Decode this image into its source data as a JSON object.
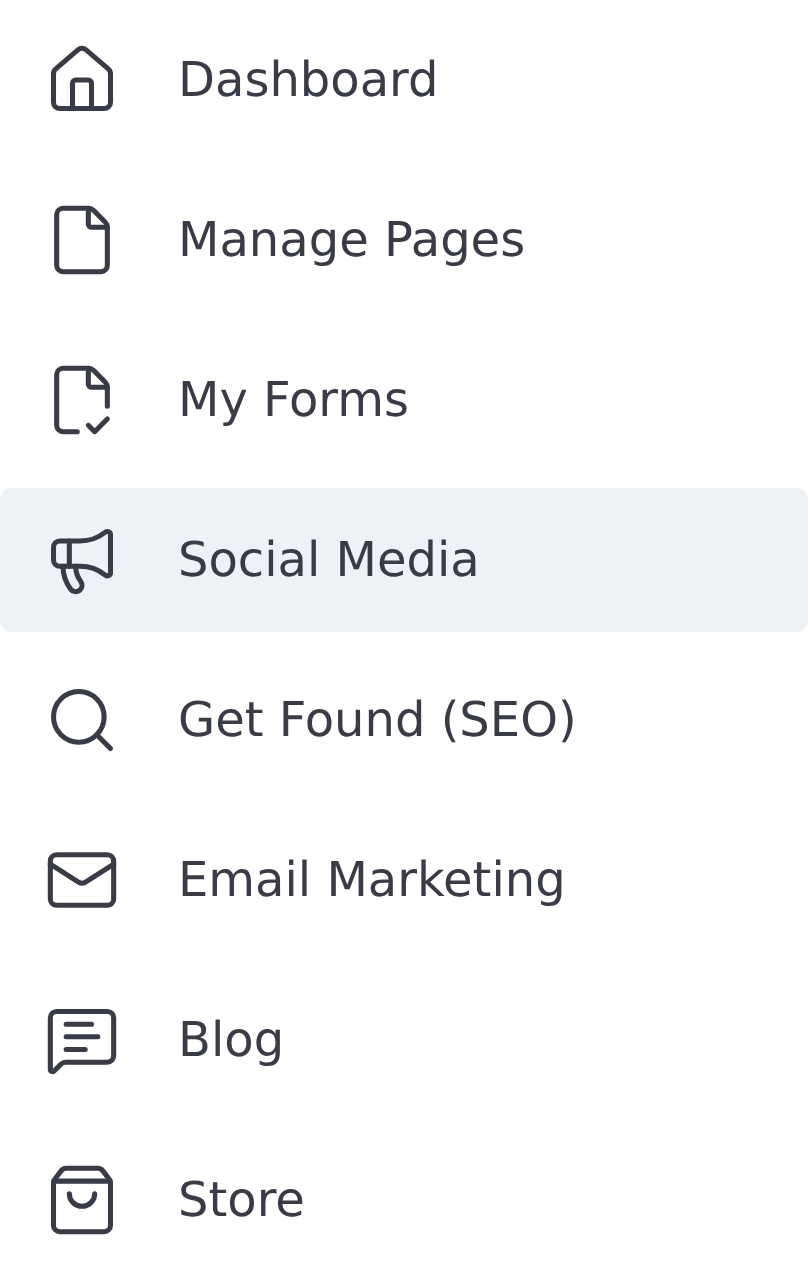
{
  "menu": {
    "items": [
      {
        "label": "Dashboard",
        "selected": false
      },
      {
        "label": "Manage Pages",
        "selected": false
      },
      {
        "label": "My Forms",
        "selected": false
      },
      {
        "label": "Social Media",
        "selected": true
      },
      {
        "label": "Get Found (SEO)",
        "selected": false
      },
      {
        "label": "Email Marketing",
        "selected": false
      },
      {
        "label": "Blog",
        "selected": false
      },
      {
        "label": "Store",
        "selected": false
      }
    ]
  }
}
